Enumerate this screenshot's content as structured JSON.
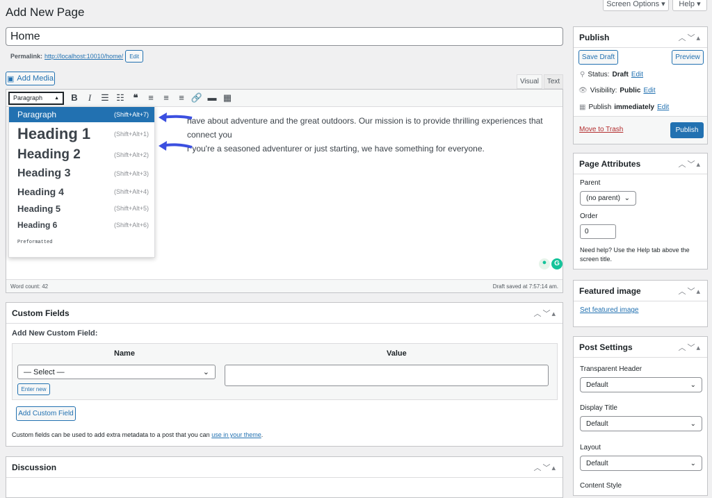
{
  "header": {
    "title": "Add New Page",
    "screen_options": "Screen Options ▾",
    "help": "Help ▾"
  },
  "title_input": {
    "value": "Home"
  },
  "permalink": {
    "label": "Permalink:",
    "url": "http://localhost:10010/home/",
    "edit": "Edit"
  },
  "editor": {
    "add_media": "Add Media",
    "tab_visual": "Visual",
    "tab_text": "Text",
    "format_select": "Paragraph",
    "toolbar_icons": [
      "bold-icon",
      "italic-icon",
      "bullet-list-icon",
      "numbered-list-icon",
      "blockquote-icon",
      "align-left-icon",
      "align-center-icon",
      "align-right-icon",
      "link-icon",
      "read-more-icon",
      "toolbar-toggle-icon"
    ],
    "content_line1": "have about adventure and the great outdoors. Our mission is to provide thrilling experiences that connect you",
    "content_line2": "r you're a seasoned adventurer or just starting, we have something for everyone.",
    "word_count": "Word count: 42",
    "draft_saved": "Draft saved at 7:57:14 am.",
    "formats": [
      {
        "label": "Paragraph",
        "shortcut": "(Shift+Alt+7)"
      },
      {
        "label": "Heading 1",
        "shortcut": "(Shift+Alt+1)"
      },
      {
        "label": "Heading 2",
        "shortcut": "(Shift+Alt+2)"
      },
      {
        "label": "Heading 3",
        "shortcut": "(Shift+Alt+3)"
      },
      {
        "label": "Heading 4",
        "shortcut": "(Shift+Alt+4)"
      },
      {
        "label": "Heading 5",
        "shortcut": "(Shift+Alt+5)"
      },
      {
        "label": "Heading 6",
        "shortcut": "(Shift+Alt+6)"
      },
      {
        "label": "Preformatted",
        "shortcut": ""
      }
    ]
  },
  "custom_fields": {
    "title": "Custom Fields",
    "add_new": "Add New Custom Field:",
    "col_name": "Name",
    "col_value": "Value",
    "select": "— Select —",
    "enter_new": "Enter new",
    "add_button": "Add Custom Field",
    "note": "Custom fields can be used to add extra metadata to a post that you can ",
    "note_link": "use in your theme",
    "note_end": "."
  },
  "discussion": {
    "title": "Discussion"
  },
  "publish": {
    "title": "Publish",
    "save_draft": "Save Draft",
    "preview": "Preview",
    "status": "Status:",
    "status_val": "Draft",
    "visibility": "Visibility:",
    "visibility_val": "Public",
    "publish_label": "Publish",
    "publish_val": "immediately",
    "edit": "Edit",
    "trash": "Move to Trash",
    "publish_button": "Publish"
  },
  "page_attributes": {
    "title": "Page Attributes",
    "parent": "Parent",
    "parent_val": "(no parent)",
    "order": "Order",
    "order_val": "0",
    "help": "Need help? Use the Help tab above the screen title."
  },
  "featured_image": {
    "title": "Featured image",
    "link": "Set featured image"
  },
  "post_settings": {
    "title": "Post Settings",
    "fields": [
      {
        "label": "Transparent Header",
        "value": "Default"
      },
      {
        "label": "Display Title",
        "value": "Default"
      },
      {
        "label": "Layout",
        "value": "Default"
      }
    ],
    "next_label": "Content Style"
  },
  "colors": {
    "accent": "#2271b1",
    "annotation_arrow": "#3b4fe0"
  }
}
